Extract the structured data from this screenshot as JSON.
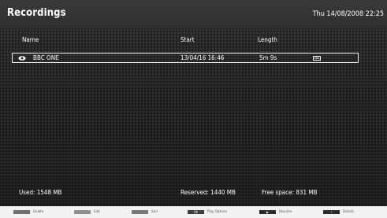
{
  "header": {
    "title": "Recordings",
    "datetime": "Thu 14/08/2008 22:25"
  },
  "columns": {
    "name": "Name",
    "start": "Start",
    "length": "Length"
  },
  "recordings": [
    {
      "name": "BBC ONE",
      "start": "13/04/16 16:46",
      "length": "5m 9s",
      "selected": true,
      "status_icon": "eye-icon",
      "info_icon": "document-icon"
    }
  ],
  "storage": {
    "used": "Used: 1548 MB",
    "reserved": "Reserved: 1440 MB",
    "free": "Free space: 831 MB"
  },
  "legend": [
    {
      "label": "Delete",
      "color": "#6f6f6f",
      "glyph": ""
    },
    {
      "label": "Edit",
      "color": "#8f8f8f",
      "glyph": ""
    },
    {
      "label": "Sort",
      "color": "#7a7a7a",
      "glyph": ""
    },
    {
      "label": "Play Options",
      "color": "#3c3c3c",
      "glyph": "OK"
    },
    {
      "label": "Resume",
      "color": "#2a2a2a",
      "glyph": "▶"
    },
    {
      "label": "Details",
      "color": "#2a2a2a",
      "glyph": "i"
    }
  ]
}
